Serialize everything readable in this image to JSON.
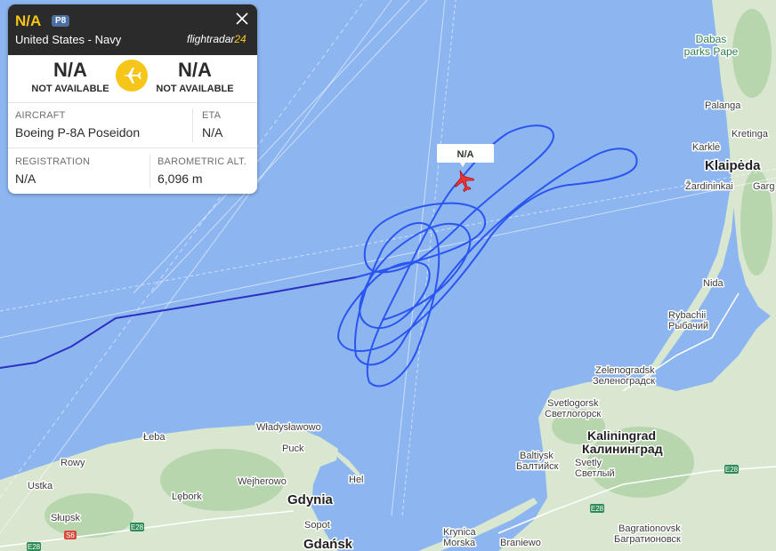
{
  "panel": {
    "callsign": "N/A",
    "type_badge": "P8",
    "operator": "United States - Navy",
    "brand_text": "flightradar",
    "brand_num": "24",
    "departure": {
      "code": "N/A",
      "name": "NOT AVAILABLE"
    },
    "arrival": {
      "code": "N/A",
      "name": "NOT AVAILABLE"
    },
    "aircraft_label": "AIRCRAFT",
    "aircraft_value": "Boeing P-8A Poseidon",
    "eta_label": "ETA",
    "eta_value": "N/A",
    "registration_label": "REGISTRATION",
    "registration_value": "N/A",
    "altitude_label": "BAROMETRIC ALT.",
    "altitude_value": "6,096 m"
  },
  "map": {
    "aircraft_label": "N/A",
    "places": {
      "dabas": "Dabas",
      "parks_pape": "parks Pape",
      "palanga": "Palanga",
      "kretinga": "Kretinga",
      "karkle": "Karklė",
      "klaipeda": "Klaipėda",
      "zardininkai": "Žardininkai",
      "garg": "Garg",
      "nida": "Nida",
      "rybachii": "Rybachii",
      "rybachii_cyr": "Рыбачий",
      "zelenogradsk": "Zelenogradsk",
      "zelenogradsk_cyr": "Зеленоградск",
      "svetlogorsk": "Svetlogorsk",
      "svetlogorsk_cyr": "Светлогорск",
      "kaliningrad": "Kaliningrad",
      "kaliningrad_cyr": "Калининград",
      "baltiysk": "Baltiysk",
      "baltiysk_cyr": "Балтийск",
      "svetly": "Svetly",
      "svetly_cyr": "Светлый",
      "bagrationovsk": "Bagrationovsk",
      "bagrationovsk_cyr": "Багратионовск",
      "braniewo": "Braniewo",
      "krynica": "Krynica",
      "morska": "Morska",
      "gdansk": "Gdańsk",
      "sopot": "Sopot",
      "gdynia": "Gdynia",
      "hel": "Hel",
      "wladyslawowo": "Władysławowo",
      "puck": "Puck",
      "weiherowo": "Wejherowo",
      "leba": "Łeba",
      "lebork": "Lębork",
      "rowy": "Rowy",
      "ustka": "Ustka",
      "slupsk": "Słupsk"
    },
    "roads": {
      "e28_a": "E28",
      "e28_b": "E28",
      "e28_c": "E28",
      "e28_d": "E28",
      "s6": "S6"
    },
    "colors": {
      "sea": "#8db6f1",
      "land": "#d7e4cf",
      "track": "#1f4ff5",
      "track_dark": "#2630c9",
      "aircraft": "#f0302f",
      "accent_yellow": "#f5c518"
    }
  }
}
